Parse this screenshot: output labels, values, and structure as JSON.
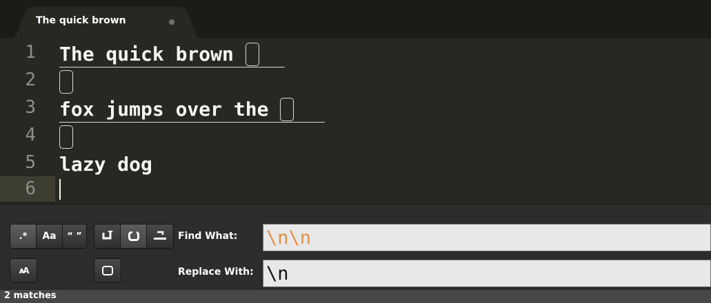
{
  "tab": {
    "title": "The quick brown"
  },
  "editor": {
    "line_numbers": [
      "1",
      "2",
      "3",
      "4",
      "5",
      "6"
    ],
    "lines": [
      "The quick brown ",
      "",
      "fox jumps over the ",
      "",
      "lazy dog",
      ""
    ]
  },
  "find_panel": {
    "options": {
      "regex_label": ".*",
      "case_label": "Aa",
      "whole_word_label": "“ ”"
    },
    "find_label": "Find What:",
    "find_value": "\\n\\n",
    "replace_label": "Replace With:",
    "replace_value": "\\n"
  },
  "status": {
    "text": "2 matches"
  },
  "colors": {
    "background": "#272822",
    "find_text": "#e0914a",
    "code_text": "#f8f8f2",
    "line_number": "#8f908a"
  },
  "icons": [
    "regex-icon",
    "case-sensitive-icon",
    "whole-word-icon",
    "wrap-icon",
    "in-selection-icon",
    "highlight-matches-icon",
    "preserve-case-icon",
    "replace-toggle-icon"
  ]
}
